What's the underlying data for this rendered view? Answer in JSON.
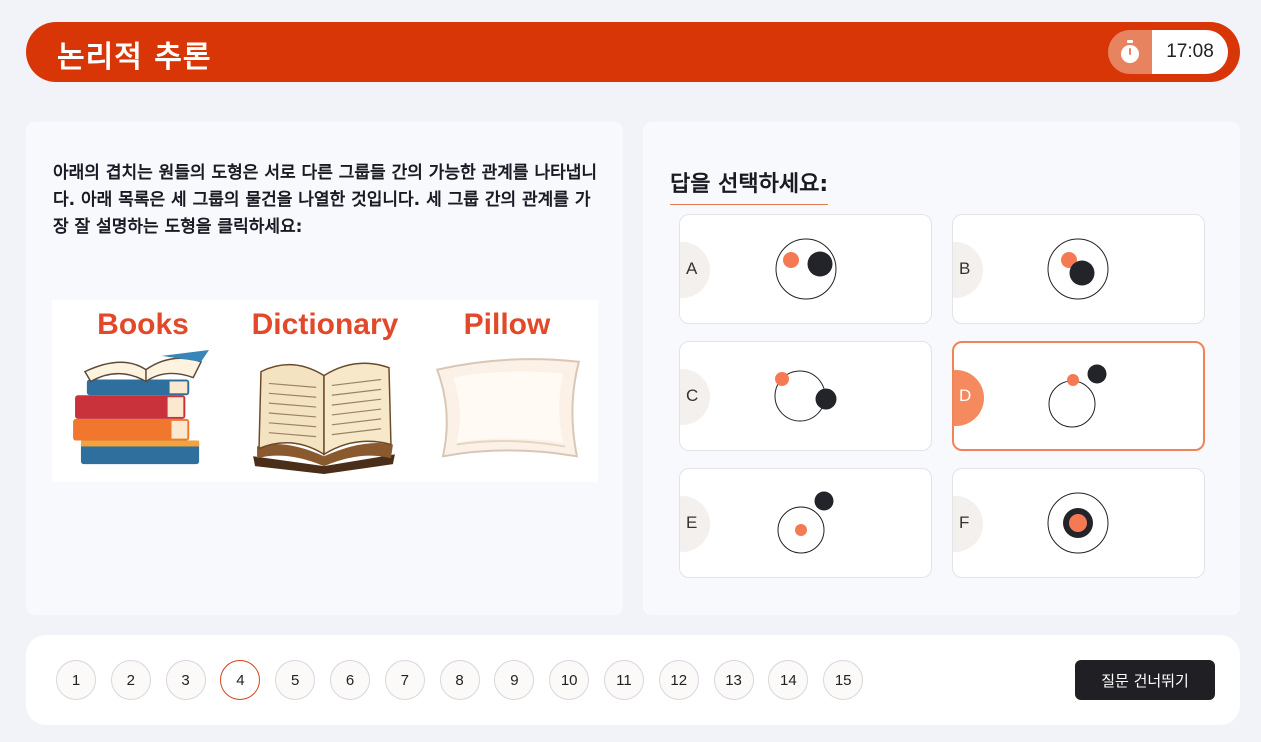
{
  "header": {
    "title": "논리적 추론",
    "timer": "17:08"
  },
  "question": {
    "text": "아래의 겹치는 원들의 도형은 서로 다른 그룹들 간의 가능한 관계를 나타냅니다. 아래 목록은 세 그룹의 물건을 나열한 것입니다. 세 그룹 간의 관계를 가장 잘 설명하는 도형을 클릭하세요:",
    "items": [
      {
        "label": "Books",
        "icon": "books-illustration"
      },
      {
        "label": "Dictionary",
        "icon": "open-book-illustration"
      },
      {
        "label": "Pillow",
        "icon": "pillow-illustration"
      }
    ]
  },
  "answers": {
    "heading": "답을 선택하세요:",
    "options": [
      {
        "letter": "A"
      },
      {
        "letter": "B"
      },
      {
        "letter": "C"
      },
      {
        "letter": "D",
        "selected": true
      },
      {
        "letter": "E"
      },
      {
        "letter": "F"
      }
    ]
  },
  "pagination": {
    "pages": [
      "1",
      "2",
      "3",
      "4",
      "5",
      "6",
      "7",
      "8",
      "9",
      "10",
      "11",
      "12",
      "13",
      "14",
      "15"
    ],
    "current": "4"
  },
  "skip_label": "질문 건너뛰기",
  "colors": {
    "primary": "#d93608",
    "accent": "#f58a5e",
    "dark": "#1f1f24"
  }
}
